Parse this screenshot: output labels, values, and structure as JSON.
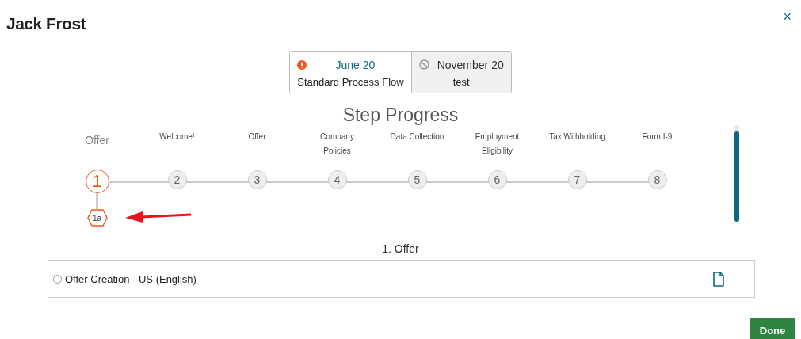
{
  "title": "Jack Frost",
  "close": "×",
  "versions": [
    {
      "date": "June 20",
      "name": "Standard Process Flow",
      "kind": "error",
      "selected": true
    },
    {
      "date": "November 20",
      "name": "test",
      "kind": "blocked",
      "selected": false
    }
  ],
  "heading": "Step Progress",
  "steps": [
    {
      "label": "Offer",
      "number": "1",
      "selected": true,
      "substeps": [
        "1a"
      ]
    },
    {
      "label": "Welcome!",
      "number": "2",
      "selected": false
    },
    {
      "label": "Offer",
      "number": "3",
      "selected": false
    },
    {
      "label": "Company Policies",
      "number": "4",
      "selected": false
    },
    {
      "label": "Data Collection",
      "number": "5",
      "selected": false
    },
    {
      "label": "Employment Eligibility",
      "number": "6",
      "selected": false
    },
    {
      "label": "Tax Withholding",
      "number": "7",
      "selected": false
    },
    {
      "label": "Form I-9",
      "number": "8",
      "selected": false
    }
  ],
  "section_title": "1. Offer",
  "tasks": [
    {
      "name": "Offer Creation - US (English)",
      "selected": false
    }
  ],
  "done_button": "Done"
}
